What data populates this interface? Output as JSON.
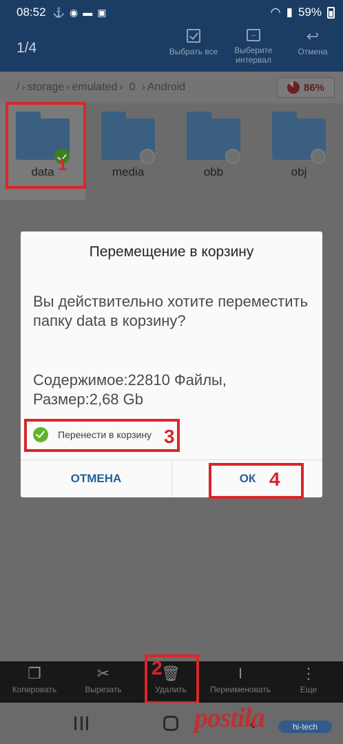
{
  "status_bar": {
    "time": "08:52",
    "battery_percent": "59%"
  },
  "app_bar": {
    "selection_count": "1/4",
    "select_all_label": "Выбрать все",
    "select_range_label": "Выберите интервал",
    "cancel_label": "Отмена"
  },
  "breadcrumb": {
    "items": [
      "/",
      "storage",
      "emulated",
      "0",
      "Android"
    ],
    "storage_used": "86%"
  },
  "folders": [
    {
      "name": "data",
      "selected": true
    },
    {
      "name": "media",
      "selected": false
    },
    {
      "name": "obb",
      "selected": false
    },
    {
      "name": "obj",
      "selected": false
    }
  ],
  "dialog": {
    "title": "Перемещение в корзину",
    "message": "Вы действительно хотите переместить папку data в корзину?",
    "info_line1": "Содержимое:22810 Файлы,",
    "info_line2": "Размер:2,68 Gb",
    "checkbox_label": "Перенести в корзину",
    "cancel_button": "ОТМЕНА",
    "ok_button": "ОК"
  },
  "annotations": [
    "1",
    "2",
    "3",
    "4"
  ],
  "action_bar": {
    "copy": "Копировать",
    "cut": "Вырезать",
    "delete": "Удалить",
    "rename": "Переименовать",
    "more": "Еще"
  },
  "watermark": "postila",
  "watermark_badge": "hi-tech",
  "colors": {
    "annotation_red": "#d8262a",
    "dialog_button_blue": "#24619a",
    "check_green": "#5fb52a"
  }
}
